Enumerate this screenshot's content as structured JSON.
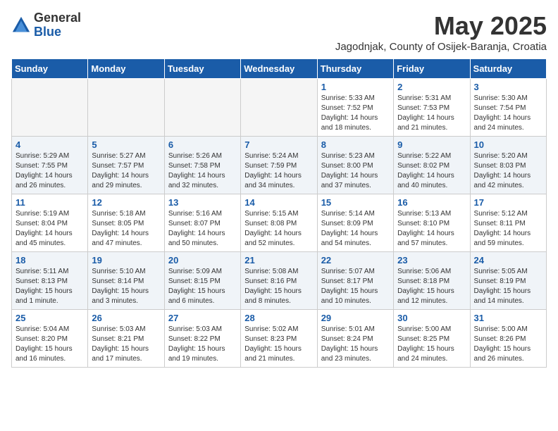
{
  "logo": {
    "general": "General",
    "blue": "Blue"
  },
  "title": "May 2025",
  "location": "Jagodnjak, County of Osijek-Baranja, Croatia",
  "days_of_week": [
    "Sunday",
    "Monday",
    "Tuesday",
    "Wednesday",
    "Thursday",
    "Friday",
    "Saturday"
  ],
  "weeks": [
    [
      {
        "day": "",
        "info": ""
      },
      {
        "day": "",
        "info": ""
      },
      {
        "day": "",
        "info": ""
      },
      {
        "day": "",
        "info": ""
      },
      {
        "day": "1",
        "info": "Sunrise: 5:33 AM\nSunset: 7:52 PM\nDaylight: 14 hours\nand 18 minutes."
      },
      {
        "day": "2",
        "info": "Sunrise: 5:31 AM\nSunset: 7:53 PM\nDaylight: 14 hours\nand 21 minutes."
      },
      {
        "day": "3",
        "info": "Sunrise: 5:30 AM\nSunset: 7:54 PM\nDaylight: 14 hours\nand 24 minutes."
      }
    ],
    [
      {
        "day": "4",
        "info": "Sunrise: 5:29 AM\nSunset: 7:55 PM\nDaylight: 14 hours\nand 26 minutes."
      },
      {
        "day": "5",
        "info": "Sunrise: 5:27 AM\nSunset: 7:57 PM\nDaylight: 14 hours\nand 29 minutes."
      },
      {
        "day": "6",
        "info": "Sunrise: 5:26 AM\nSunset: 7:58 PM\nDaylight: 14 hours\nand 32 minutes."
      },
      {
        "day": "7",
        "info": "Sunrise: 5:24 AM\nSunset: 7:59 PM\nDaylight: 14 hours\nand 34 minutes."
      },
      {
        "day": "8",
        "info": "Sunrise: 5:23 AM\nSunset: 8:00 PM\nDaylight: 14 hours\nand 37 minutes."
      },
      {
        "day": "9",
        "info": "Sunrise: 5:22 AM\nSunset: 8:02 PM\nDaylight: 14 hours\nand 40 minutes."
      },
      {
        "day": "10",
        "info": "Sunrise: 5:20 AM\nSunset: 8:03 PM\nDaylight: 14 hours\nand 42 minutes."
      }
    ],
    [
      {
        "day": "11",
        "info": "Sunrise: 5:19 AM\nSunset: 8:04 PM\nDaylight: 14 hours\nand 45 minutes."
      },
      {
        "day": "12",
        "info": "Sunrise: 5:18 AM\nSunset: 8:05 PM\nDaylight: 14 hours\nand 47 minutes."
      },
      {
        "day": "13",
        "info": "Sunrise: 5:16 AM\nSunset: 8:07 PM\nDaylight: 14 hours\nand 50 minutes."
      },
      {
        "day": "14",
        "info": "Sunrise: 5:15 AM\nSunset: 8:08 PM\nDaylight: 14 hours\nand 52 minutes."
      },
      {
        "day": "15",
        "info": "Sunrise: 5:14 AM\nSunset: 8:09 PM\nDaylight: 14 hours\nand 54 minutes."
      },
      {
        "day": "16",
        "info": "Sunrise: 5:13 AM\nSunset: 8:10 PM\nDaylight: 14 hours\nand 57 minutes."
      },
      {
        "day": "17",
        "info": "Sunrise: 5:12 AM\nSunset: 8:11 PM\nDaylight: 14 hours\nand 59 minutes."
      }
    ],
    [
      {
        "day": "18",
        "info": "Sunrise: 5:11 AM\nSunset: 8:13 PM\nDaylight: 15 hours\nand 1 minute."
      },
      {
        "day": "19",
        "info": "Sunrise: 5:10 AM\nSunset: 8:14 PM\nDaylight: 15 hours\nand 3 minutes."
      },
      {
        "day": "20",
        "info": "Sunrise: 5:09 AM\nSunset: 8:15 PM\nDaylight: 15 hours\nand 6 minutes."
      },
      {
        "day": "21",
        "info": "Sunrise: 5:08 AM\nSunset: 8:16 PM\nDaylight: 15 hours\nand 8 minutes."
      },
      {
        "day": "22",
        "info": "Sunrise: 5:07 AM\nSunset: 8:17 PM\nDaylight: 15 hours\nand 10 minutes."
      },
      {
        "day": "23",
        "info": "Sunrise: 5:06 AM\nSunset: 8:18 PM\nDaylight: 15 hours\nand 12 minutes."
      },
      {
        "day": "24",
        "info": "Sunrise: 5:05 AM\nSunset: 8:19 PM\nDaylight: 15 hours\nand 14 minutes."
      }
    ],
    [
      {
        "day": "25",
        "info": "Sunrise: 5:04 AM\nSunset: 8:20 PM\nDaylight: 15 hours\nand 16 minutes."
      },
      {
        "day": "26",
        "info": "Sunrise: 5:03 AM\nSunset: 8:21 PM\nDaylight: 15 hours\nand 17 minutes."
      },
      {
        "day": "27",
        "info": "Sunrise: 5:03 AM\nSunset: 8:22 PM\nDaylight: 15 hours\nand 19 minutes."
      },
      {
        "day": "28",
        "info": "Sunrise: 5:02 AM\nSunset: 8:23 PM\nDaylight: 15 hours\nand 21 minutes."
      },
      {
        "day": "29",
        "info": "Sunrise: 5:01 AM\nSunset: 8:24 PM\nDaylight: 15 hours\nand 23 minutes."
      },
      {
        "day": "30",
        "info": "Sunrise: 5:00 AM\nSunset: 8:25 PM\nDaylight: 15 hours\nand 24 minutes."
      },
      {
        "day": "31",
        "info": "Sunrise: 5:00 AM\nSunset: 8:26 PM\nDaylight: 15 hours\nand 26 minutes."
      }
    ]
  ]
}
